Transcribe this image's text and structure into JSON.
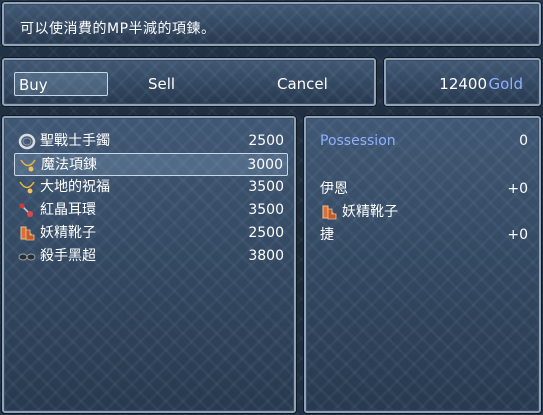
{
  "help_text": "可以使消費的MP半減的項鍊。",
  "commands": {
    "buy": "Buy",
    "sell": "Sell",
    "cancel": "Cancel"
  },
  "gold": {
    "amount": "12400",
    "unit": "Gold"
  },
  "items": [
    {
      "icon": "bracelet-icon",
      "name": "聖戰士手鐲",
      "price": "2500"
    },
    {
      "icon": "necklace-icon",
      "name": "魔法項鍊",
      "price": "3000"
    },
    {
      "icon": "necklace-icon",
      "name": "大地的祝福",
      "price": "3500"
    },
    {
      "icon": "earring-icon",
      "name": "紅晶耳環",
      "price": "3500"
    },
    {
      "icon": "boots-icon",
      "name": "妖精靴子",
      "price": "2500"
    },
    {
      "icon": "glasses-icon",
      "name": "殺手黑超",
      "price": "3800"
    }
  ],
  "selected_index": 1,
  "status": {
    "possession_label": "Possession",
    "possession_value": "0",
    "actor1_name": "伊恩",
    "actor1_value": "+0",
    "equipped_item_icon": "boots-icon",
    "equipped_item_name": "妖精靴子",
    "actor2_name": "捷",
    "actor2_value": "+0"
  },
  "colors": {
    "system_blue": "#8fb0ff",
    "text": "#ffffff"
  }
}
